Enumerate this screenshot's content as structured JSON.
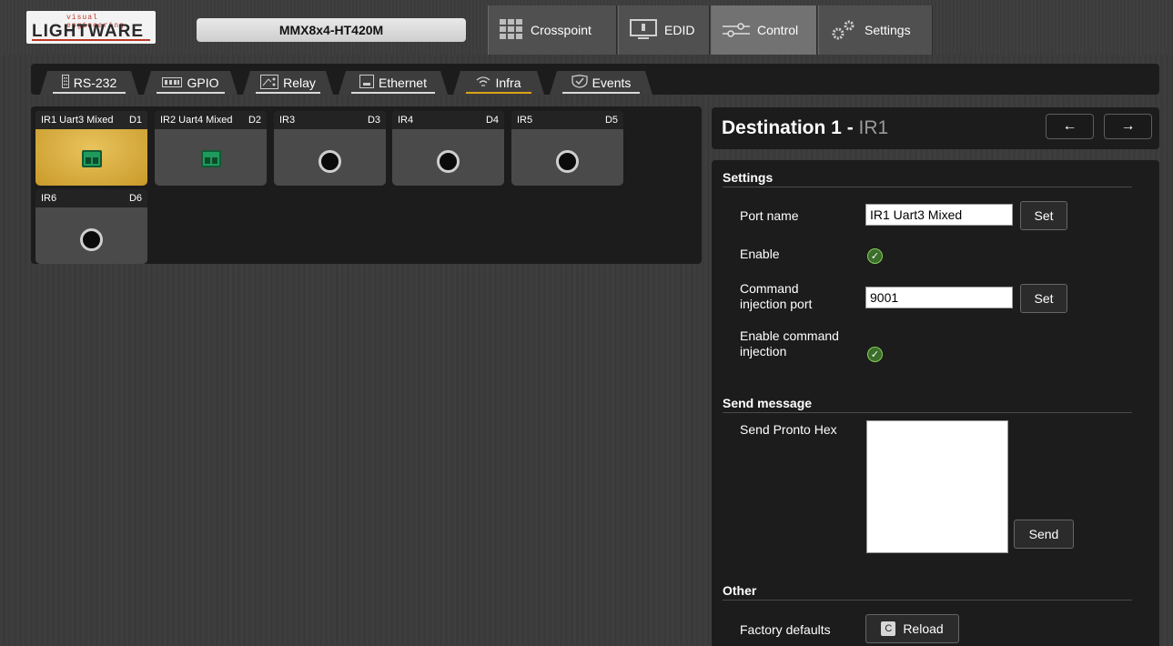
{
  "brand": {
    "tagline": "visual engineering",
    "name": "LIGHTWARE"
  },
  "device": {
    "name": "MMX8x4-HT420M"
  },
  "nav": {
    "crosspoint": "Crosspoint",
    "edid": "EDID",
    "control": "Control",
    "settings": "Settings"
  },
  "subtabs": {
    "rs232": "RS-232",
    "gpio": "GPIO",
    "relay": "Relay",
    "ethernet": "Ethernet",
    "infra": "Infra",
    "events": "Events",
    "active": "Infra"
  },
  "ports": [
    {
      "name": "IR1 Uart3 Mixed",
      "id": "D1",
      "type": "terminal",
      "selected": true
    },
    {
      "name": "IR2 Uart4 Mixed",
      "id": "D2",
      "type": "terminal",
      "selected": false
    },
    {
      "name": "IR3",
      "id": "D3",
      "type": "jack",
      "selected": false
    },
    {
      "name": "IR4",
      "id": "D4",
      "type": "jack",
      "selected": false
    },
    {
      "name": "IR5",
      "id": "D5",
      "type": "jack",
      "selected": false
    },
    {
      "name": "IR6",
      "id": "D6",
      "type": "jack",
      "selected": false
    }
  ],
  "destination": {
    "title": "Destination 1",
    "separator": " - ",
    "subtitle": "IR1",
    "prev_icon": "←",
    "next_icon": "→"
  },
  "settings_section": {
    "heading": "Settings",
    "port_name_label": "Port name",
    "port_name_value": "IR1 Uart3 Mixed",
    "set_label": "Set",
    "enable_label": "Enable",
    "command_port_label_1": "Command",
    "command_port_label_2": "injection port",
    "command_port_value": "9001",
    "enable_injection_label_1": "Enable command",
    "enable_injection_label_2": "injection"
  },
  "send_section": {
    "heading": "Send message",
    "pronto_label": "Send Pronto Hex",
    "pronto_value": "",
    "send_label": "Send"
  },
  "other_section": {
    "heading": "Other",
    "factory_label": "Factory defaults",
    "reload_label": "Reload"
  },
  "colors": {
    "accent": "#d9a21a",
    "panel": "#1c1c1c",
    "check_green": "#8ad05b"
  }
}
